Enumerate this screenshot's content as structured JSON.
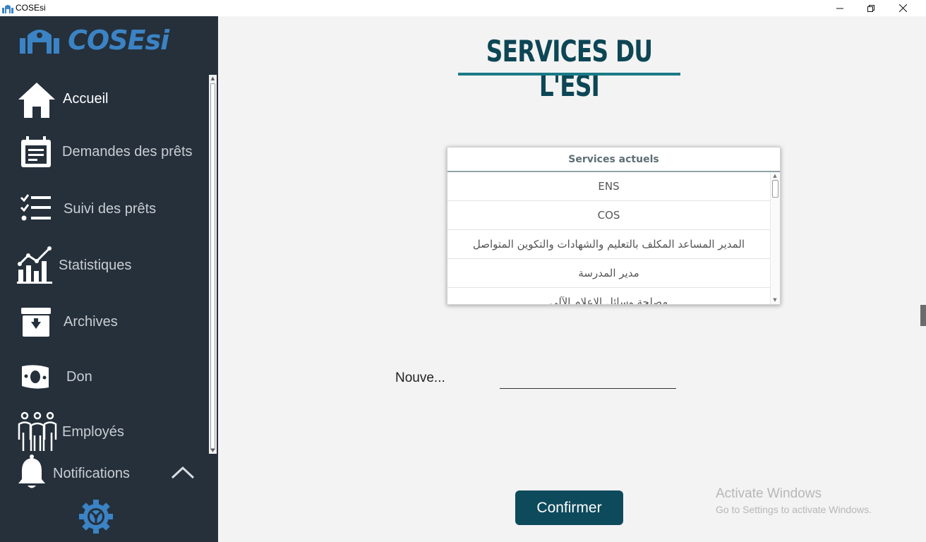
{
  "window": {
    "title": "COSEsi",
    "minimize": "—",
    "restore": "❐",
    "close": "✕"
  },
  "sidebar": {
    "logo": "COSEsi",
    "items": [
      {
        "label": "Accueil",
        "icon": "home-icon"
      },
      {
        "label": "Demandes des prêts",
        "icon": "calendar-icon"
      },
      {
        "label": "Suivi des prêts",
        "icon": "checklist-icon"
      },
      {
        "label": "Statistiques",
        "icon": "chart-icon"
      },
      {
        "label": "Archives",
        "icon": "archive-icon"
      },
      {
        "label": "Don",
        "icon": "money-icon"
      },
      {
        "label": "Employés",
        "icon": "people-icon"
      },
      {
        "label": "Notifications",
        "icon": "bell-icon"
      }
    ],
    "settings_icon": "gear-icon",
    "collapse_icon": "chevron-up-icon"
  },
  "main": {
    "title": "SERVICES DU L'ESI",
    "table": {
      "header": "Services actuels",
      "rows": [
        "ENS",
        "COS",
        "المدير المساعد المكلف بالتعليم والشهادات والتكوين المتواصل",
        "مدير المدرسة",
        "مصلحة وسائل الإعلام الآلي"
      ]
    },
    "field_label": "Nouve...",
    "field_value": "",
    "confirm_label": "Confirmer"
  },
  "watermark": {
    "line1": "Activate Windows",
    "line2": "Go to Settings to activate Windows."
  },
  "colors": {
    "sidebar_bg": "#25303b",
    "accent": "#0d4a5c",
    "logo_blue": "#3b83c4"
  }
}
